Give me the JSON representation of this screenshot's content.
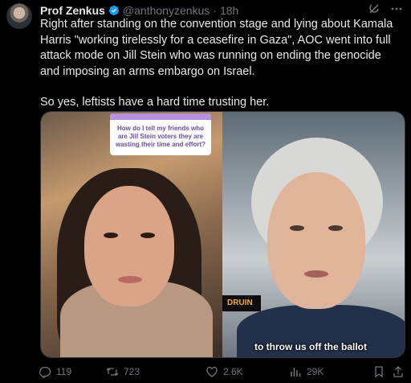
{
  "author": {
    "name": "Prof Zenkus",
    "handle": "@anthonyzenkus",
    "separator": "·",
    "time": "18h"
  },
  "tweet": {
    "paragraph1": "Right after standing on the convention stage and lying about Kamala Harris \"working tirelessly for a ceasefire in Gaza\", AOC went into full attack mode on Jill Stein who was running on ending the genocide and imposing an arms embargo on Israel.",
    "paragraph2": "So yes, leftists have a hard time trusting her."
  },
  "media": {
    "question_card": "How do I tell my friends who are Jill Stein voters they are wasting their time and effort?",
    "sign_text": "DRUIN",
    "caption": "to throw us off the ballot"
  },
  "stats": {
    "replies": "119",
    "reposts": "723",
    "likes": "2.6K",
    "views": "29K"
  },
  "colors": {
    "accent": "#1d9bf0",
    "secondary_text": "#71767b",
    "background": "#000000"
  },
  "icons": [
    "verified-badge-icon",
    "grok-icon",
    "more-icon",
    "reply-icon",
    "repost-icon",
    "like-icon",
    "views-icon",
    "bookmark-icon",
    "share-icon"
  ]
}
